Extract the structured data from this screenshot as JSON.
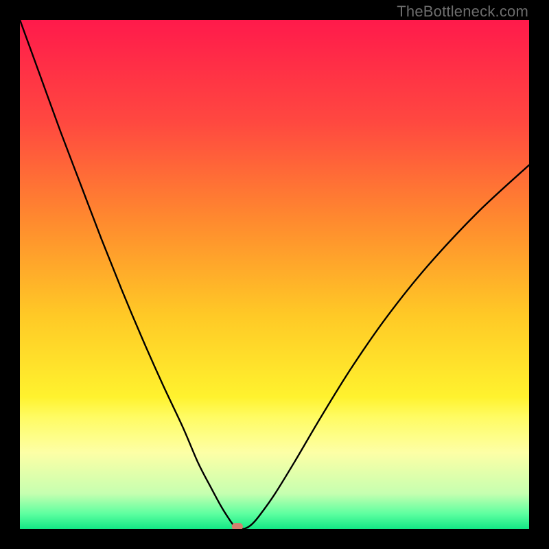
{
  "watermark": "TheBottleneck.com",
  "chart_data": {
    "type": "line",
    "title": "",
    "xlabel": "",
    "ylabel": "",
    "xlim": [
      0,
      100
    ],
    "ylim": [
      0,
      100
    ],
    "background_gradient": {
      "stops": [
        {
          "pct": 0,
          "color": "#ff1a4b"
        },
        {
          "pct": 20,
          "color": "#ff4840"
        },
        {
          "pct": 40,
          "color": "#ff8c2e"
        },
        {
          "pct": 58,
          "color": "#ffc926"
        },
        {
          "pct": 74,
          "color": "#fff22e"
        },
        {
          "pct": 78,
          "color": "#fffc63"
        },
        {
          "pct": 85,
          "color": "#fdffa6"
        },
        {
          "pct": 93,
          "color": "#c6ffb0"
        },
        {
          "pct": 97,
          "color": "#5dffa0"
        },
        {
          "pct": 100,
          "color": "#12e885"
        }
      ]
    },
    "series": [
      {
        "name": "bottleneck-curve",
        "color": "#000000",
        "x": [
          0,
          4,
          8,
          12,
          16,
          20,
          24,
          28,
          32,
          35,
          37.5,
          39.5,
          41,
          42,
          42.7,
          44.2,
          45.5,
          47,
          50,
          54,
          59,
          65,
          72,
          80,
          90,
          100
        ],
        "y": [
          100,
          89,
          78,
          67.5,
          57,
          47,
          37.5,
          28.5,
          20,
          13,
          8.2,
          4.5,
          2.1,
          0.7,
          0.1,
          0.12,
          0.9,
          2.6,
          6.8,
          13.3,
          21.8,
          31.5,
          41.6,
          51.6,
          62.3,
          71.5
        ]
      }
    ],
    "marker": {
      "name": "optimal-point",
      "x": 42.7,
      "y": 0.5,
      "width": 2.2,
      "height": 1.4,
      "color": "#d4806f"
    }
  }
}
